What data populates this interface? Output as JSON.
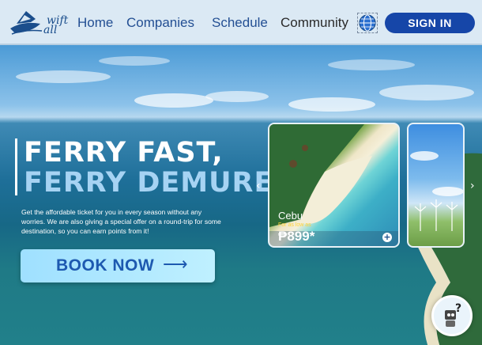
{
  "header": {
    "logo_text_line1": "wift",
    "logo_text_line2": "all",
    "nav": [
      "Home",
      "Companies",
      "Schedule",
      "Community"
    ],
    "signin_label": "SIGN IN"
  },
  "hero": {
    "title_line1": "FERRY FAST,",
    "title_line2": "FERRY DEMURE",
    "description": "Get the affordable ticket for you in every season without any worries. We are also giving a special offer on a round-trip for some destination, so you can earn points from it!",
    "cta_label": "BOOK NOW",
    "cta_arrow": "⟶"
  },
  "carousel": {
    "cards": [
      {
        "city": "Cebu",
        "from_label": "For as low as",
        "price": "₱899*"
      },
      {
        "city": "",
        "from_label": "",
        "price": ""
      }
    ],
    "prev_glyph": "‹",
    "next_glyph": "›",
    "add_glyph": "+"
  },
  "icons": {
    "globe": "globe-icon",
    "chatbot": "chatbot-icon"
  },
  "colors": {
    "brand_blue": "#1646a8",
    "nav_blue": "#234f93",
    "cta_bg": "#9fe0ff",
    "price_yellow": "#ffd33a"
  }
}
